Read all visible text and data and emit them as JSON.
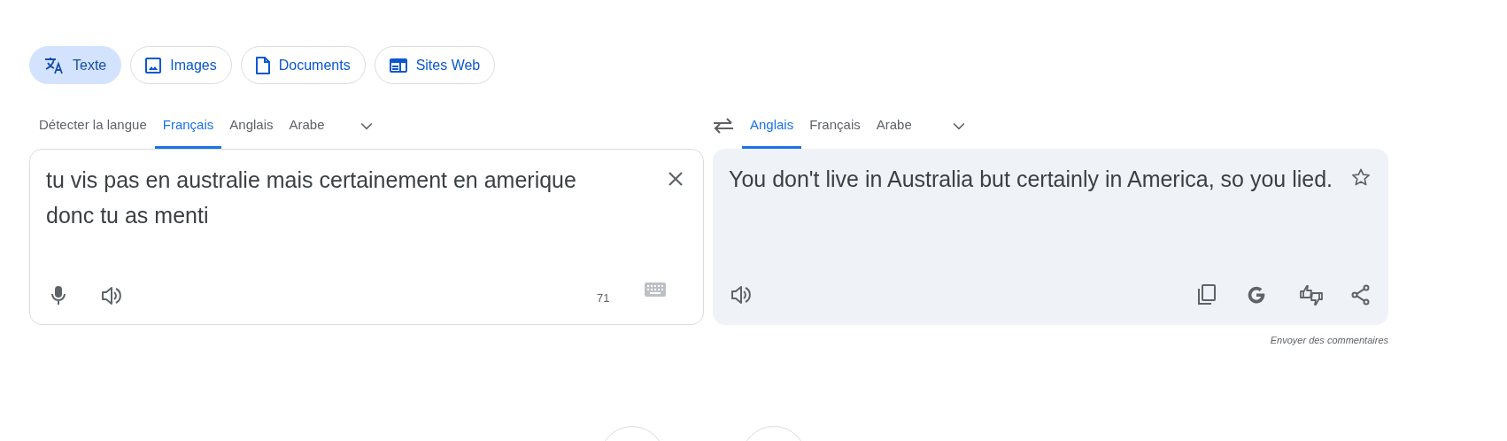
{
  "mode_tabs": [
    {
      "label": "Texte",
      "kind": "text",
      "selected": true
    },
    {
      "label": "Images",
      "kind": "image",
      "selected": false
    },
    {
      "label": "Documents",
      "kind": "document",
      "selected": false
    },
    {
      "label": "Sites Web",
      "kind": "website",
      "selected": false
    }
  ],
  "source_languages": [
    {
      "label": "Détecter la langue",
      "selected": false
    },
    {
      "label": "Français",
      "selected": true
    },
    {
      "label": "Anglais",
      "selected": false
    },
    {
      "label": "Arabe",
      "selected": false
    }
  ],
  "target_languages": [
    {
      "label": "Anglais",
      "selected": true
    },
    {
      "label": "Français",
      "selected": false
    },
    {
      "label": "Arabe",
      "selected": false
    }
  ],
  "source": {
    "text": "tu vis pas en australie mais certainement en amerique donc tu as menti",
    "char_count": "71"
  },
  "translation": {
    "text": "You don't live in Australia but certainly in America, so you lied."
  },
  "feedback_link": "Envoyer des commentaires"
}
